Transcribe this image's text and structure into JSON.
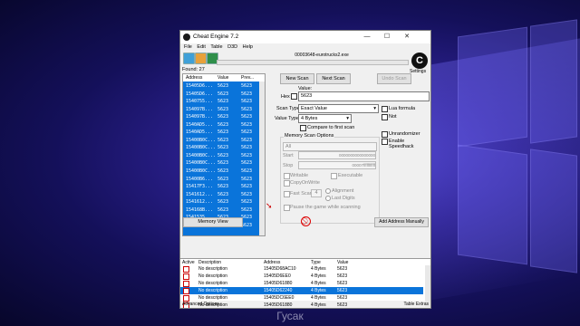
{
  "window": {
    "title": "Cheat Engine 7.2",
    "minimize": "—",
    "maximize": "☐",
    "close": "✕"
  },
  "menu": [
    "File",
    "Edit",
    "Table",
    "D3D",
    "Help"
  ],
  "process_name": "00003648-eurotrucks2.exe",
  "found": "Found: 27",
  "settings_label": "Settings",
  "results": {
    "columns": [
      "Address",
      "Value",
      "Prev..."
    ],
    "rows": [
      [
        "15405D6...",
        "5623",
        "5623"
      ],
      [
        "15405D6...",
        "5623",
        "5623"
      ],
      [
        "1540755...",
        "5623",
        "5623"
      ],
      [
        "154097B...",
        "5623",
        "5623"
      ],
      [
        "154097B...",
        "5623",
        "5623"
      ],
      [
        "1540AD5...",
        "5623",
        "5623"
      ],
      [
        "1540AD5...",
        "5623",
        "5623"
      ],
      [
        "15400B0C...",
        "5623",
        "5623"
      ],
      [
        "15400B0C...",
        "5623",
        "5623"
      ],
      [
        "15400B0C...",
        "5623",
        "5623"
      ],
      [
        "15400B0C...",
        "5623",
        "5623"
      ],
      [
        "15400B0C...",
        "5623",
        "5623"
      ],
      [
        "15400B6...",
        "5623",
        "5623"
      ],
      [
        "15417F3...",
        "5623",
        "5623"
      ],
      [
        "1541612...",
        "5623",
        "5623"
      ],
      [
        "1541612...",
        "5623",
        "5623"
      ],
      [
        "154168B...",
        "5623",
        "5623"
      ],
      [
        "1541535...",
        "5623",
        "5623"
      ],
      [
        "1541535...",
        "5623",
        "5623"
      ]
    ]
  },
  "scan": {
    "new_scan": "New Scan",
    "next_scan": "Next Scan",
    "undo_scan": "Undo Scan",
    "value_label": "Value:",
    "hex_label": "Hex",
    "value": "5623",
    "scan_type_label": "Scan Type",
    "scan_type": "Exact Value",
    "value_type_label": "Value Type",
    "value_type": "4 Bytes",
    "compare_first": "Compare to first scan",
    "lua_formula": "Lua formula",
    "not_label": "Not",
    "memory_options": "Memory Scan Options",
    "region": "All",
    "start_label": "Start",
    "start_value": "0000000000000000",
    "stop_label": "Stop",
    "stop_value": "00007fffffffffff",
    "writable": "Writable",
    "executable": "Executable",
    "copy_on_write": "CopyOnWrite",
    "fast_scan": "Fast Scan",
    "fast_scan_value": "4",
    "alignment": "Alignment",
    "last_digits": "Last Digits",
    "pause_game": "Pause the game while scanning",
    "unrandomizer": "Unrandomizer",
    "enable_speedhack": "Enable Speedhack"
  },
  "memory_view": "Memory View",
  "add_address": "Add Address Manually",
  "table": {
    "columns": [
      "Active",
      "Description",
      "Address",
      "Type",
      "Value"
    ],
    "rows": [
      {
        "description": "No description",
        "address": "15405D68AC10",
        "type": "4 Bytes",
        "value": "5623",
        "selected": false
      },
      {
        "description": "No description",
        "address": "15405D6EE0",
        "type": "4 Bytes",
        "value": "5623",
        "selected": false
      },
      {
        "description": "No description",
        "address": "15405D61880",
        "type": "4 Bytes",
        "value": "5623",
        "selected": false
      },
      {
        "description": "No description",
        "address": "15405D62240",
        "type": "4 Bytes",
        "value": "5623",
        "selected": true
      },
      {
        "description": "No description",
        "address": "15405DC6EE0",
        "type": "4 Bytes",
        "value": "5623",
        "selected": false
      },
      {
        "description": "No description",
        "address": "15405D61880",
        "type": "4 Bytes",
        "value": "5623",
        "selected": false
      },
      {
        "description": "No description",
        "address": "15405D62240",
        "type": "4 Bytes",
        "value": "5623",
        "selected": true
      },
      {
        "description": "No description",
        "address": "15405D630E0",
        "type": "4 Bytes",
        "value": "5623",
        "selected": false
      }
    ]
  },
  "status": {
    "left": "Advanced Options",
    "right": "Table Extras"
  },
  "caption": "Гусак"
}
